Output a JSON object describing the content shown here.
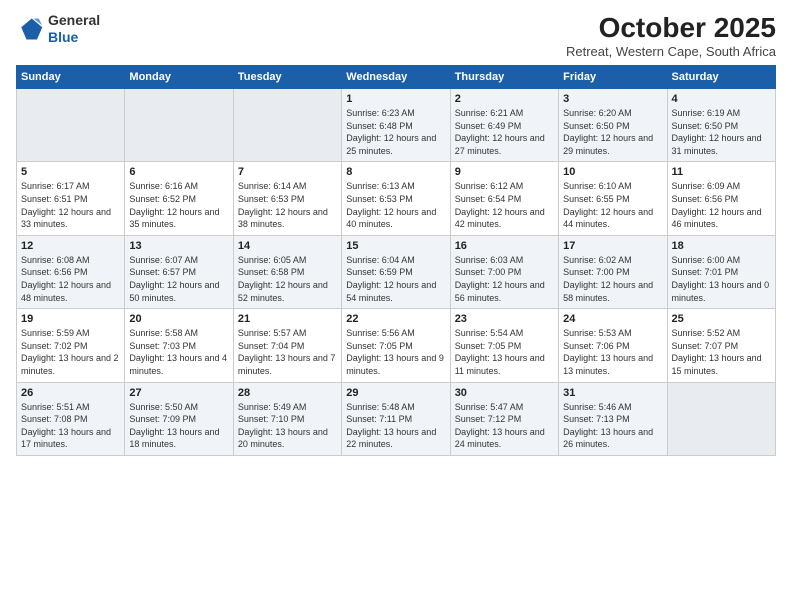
{
  "header": {
    "logo_general": "General",
    "logo_blue": "Blue",
    "month_year": "October 2025",
    "location": "Retreat, Western Cape, South Africa"
  },
  "days_of_week": [
    "Sunday",
    "Monday",
    "Tuesday",
    "Wednesday",
    "Thursday",
    "Friday",
    "Saturday"
  ],
  "weeks": [
    [
      {
        "day": "",
        "empty": true
      },
      {
        "day": "",
        "empty": true
      },
      {
        "day": "",
        "empty": true
      },
      {
        "day": "1",
        "sunrise": "6:23 AM",
        "sunset": "6:48 PM",
        "daylight": "12 hours and 25 minutes."
      },
      {
        "day": "2",
        "sunrise": "6:21 AM",
        "sunset": "6:49 PM",
        "daylight": "12 hours and 27 minutes."
      },
      {
        "day": "3",
        "sunrise": "6:20 AM",
        "sunset": "6:50 PM",
        "daylight": "12 hours and 29 minutes."
      },
      {
        "day": "4",
        "sunrise": "6:19 AM",
        "sunset": "6:50 PM",
        "daylight": "12 hours and 31 minutes."
      }
    ],
    [
      {
        "day": "5",
        "sunrise": "6:17 AM",
        "sunset": "6:51 PM",
        "daylight": "12 hours and 33 minutes."
      },
      {
        "day": "6",
        "sunrise": "6:16 AM",
        "sunset": "6:52 PM",
        "daylight": "12 hours and 35 minutes."
      },
      {
        "day": "7",
        "sunrise": "6:14 AM",
        "sunset": "6:53 PM",
        "daylight": "12 hours and 38 minutes."
      },
      {
        "day": "8",
        "sunrise": "6:13 AM",
        "sunset": "6:53 PM",
        "daylight": "12 hours and 40 minutes."
      },
      {
        "day": "9",
        "sunrise": "6:12 AM",
        "sunset": "6:54 PM",
        "daylight": "12 hours and 42 minutes."
      },
      {
        "day": "10",
        "sunrise": "6:10 AM",
        "sunset": "6:55 PM",
        "daylight": "12 hours and 44 minutes."
      },
      {
        "day": "11",
        "sunrise": "6:09 AM",
        "sunset": "6:56 PM",
        "daylight": "12 hours and 46 minutes."
      }
    ],
    [
      {
        "day": "12",
        "sunrise": "6:08 AM",
        "sunset": "6:56 PM",
        "daylight": "12 hours and 48 minutes."
      },
      {
        "day": "13",
        "sunrise": "6:07 AM",
        "sunset": "6:57 PM",
        "daylight": "12 hours and 50 minutes."
      },
      {
        "day": "14",
        "sunrise": "6:05 AM",
        "sunset": "6:58 PM",
        "daylight": "12 hours and 52 minutes."
      },
      {
        "day": "15",
        "sunrise": "6:04 AM",
        "sunset": "6:59 PM",
        "daylight": "12 hours and 54 minutes."
      },
      {
        "day": "16",
        "sunrise": "6:03 AM",
        "sunset": "7:00 PM",
        "daylight": "12 hours and 56 minutes."
      },
      {
        "day": "17",
        "sunrise": "6:02 AM",
        "sunset": "7:00 PM",
        "daylight": "12 hours and 58 minutes."
      },
      {
        "day": "18",
        "sunrise": "6:00 AM",
        "sunset": "7:01 PM",
        "daylight": "13 hours and 0 minutes."
      }
    ],
    [
      {
        "day": "19",
        "sunrise": "5:59 AM",
        "sunset": "7:02 PM",
        "daylight": "13 hours and 2 minutes."
      },
      {
        "day": "20",
        "sunrise": "5:58 AM",
        "sunset": "7:03 PM",
        "daylight": "13 hours and 4 minutes."
      },
      {
        "day": "21",
        "sunrise": "5:57 AM",
        "sunset": "7:04 PM",
        "daylight": "13 hours and 7 minutes."
      },
      {
        "day": "22",
        "sunrise": "5:56 AM",
        "sunset": "7:05 PM",
        "daylight": "13 hours and 9 minutes."
      },
      {
        "day": "23",
        "sunrise": "5:54 AM",
        "sunset": "7:05 PM",
        "daylight": "13 hours and 11 minutes."
      },
      {
        "day": "24",
        "sunrise": "5:53 AM",
        "sunset": "7:06 PM",
        "daylight": "13 hours and 13 minutes."
      },
      {
        "day": "25",
        "sunrise": "5:52 AM",
        "sunset": "7:07 PM",
        "daylight": "13 hours and 15 minutes."
      }
    ],
    [
      {
        "day": "26",
        "sunrise": "5:51 AM",
        "sunset": "7:08 PM",
        "daylight": "13 hours and 17 minutes."
      },
      {
        "day": "27",
        "sunrise": "5:50 AM",
        "sunset": "7:09 PM",
        "daylight": "13 hours and 18 minutes."
      },
      {
        "day": "28",
        "sunrise": "5:49 AM",
        "sunset": "7:10 PM",
        "daylight": "13 hours and 20 minutes."
      },
      {
        "day": "29",
        "sunrise": "5:48 AM",
        "sunset": "7:11 PM",
        "daylight": "13 hours and 22 minutes."
      },
      {
        "day": "30",
        "sunrise": "5:47 AM",
        "sunset": "7:12 PM",
        "daylight": "13 hours and 24 minutes."
      },
      {
        "day": "31",
        "sunrise": "5:46 AM",
        "sunset": "7:13 PM",
        "daylight": "13 hours and 26 minutes."
      },
      {
        "day": "",
        "empty": true
      }
    ]
  ]
}
